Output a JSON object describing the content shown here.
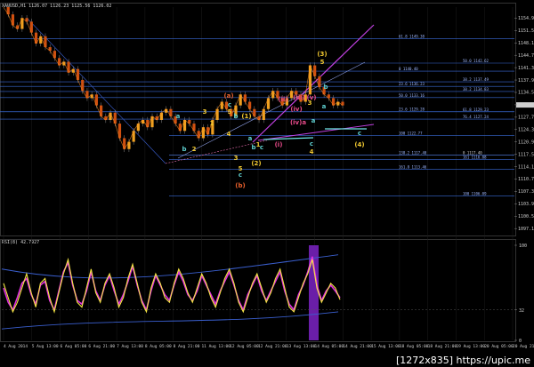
{
  "price_panel": {
    "title": "XAUUSD,H1  1126.07 1126.23 1125.56 1126.02"
  },
  "rsi_panel": {
    "title": "RSI(8) 42.7927",
    "y_ticks": [
      "100",
      "32",
      "0"
    ]
  },
  "watermark": "[1272x835] https://upic.me",
  "chart_data": {
    "type": "candlestick",
    "ylim": [
      1096,
      1158
    ],
    "y_ticks": [
      1154.97,
      1151.57,
      1148.17,
      1144.77,
      1141.37,
      1137.97,
      1134.57,
      1131.17,
      1127.77,
      1124.37,
      1120.97,
      1117.57,
      1114.17,
      1110.77,
      1107.37,
      1103.97,
      1100.57,
      1097.17
    ],
    "current_price": "1131.13",
    "x_ticks": [
      "4 Aug 2014",
      "5 Aug 13:00",
      "6 Aug 05:00",
      "6 Aug 21:00",
      "7 Aug 13:00",
      "8 Aug 05:00",
      "8 Aug 21:00",
      "11 Aug 13:00",
      "12 Aug 05:00",
      "12 Aug 21:00",
      "13 Aug 13:00",
      "14 Aug 05:00",
      "14 Aug 21:00",
      "15 Aug 13:00",
      "18 Aug 05:00",
      "18 Aug 21:00",
      "19 Aug 13:00",
      "20 Aug 05:00",
      "20 Aug 21:00"
    ],
    "price_path": [
      1158,
      1156,
      1153,
      1152,
      1155,
      1154,
      1151,
      1148,
      1150,
      1147,
      1146,
      1144,
      1142,
      1143,
      1140,
      1141,
      1138,
      1135,
      1133,
      1134,
      1131,
      1128,
      1127,
      1129,
      1126,
      1122,
      1119,
      1121,
      1124,
      1126,
      1127,
      1125,
      1128,
      1127,
      1129,
      1130,
      1128,
      1126,
      1124,
      1127,
      1126,
      1124,
      1122,
      1125,
      1123,
      1127,
      1130,
      1132,
      1130,
      1128,
      1131,
      1134,
      1132,
      1130,
      1128,
      1127,
      1130,
      1133,
      1135,
      1133,
      1131,
      1133,
      1135,
      1134,
      1132,
      1134,
      1142,
      1139,
      1136,
      1134,
      1133,
      1131,
      1132,
      1131
    ],
    "fib_levels": [
      {
        "label": "61.8  1149.38",
        "value": 1149.38,
        "color": "#3a6bd8"
      },
      {
        "label": "50.0  1142.62",
        "value": 1142.62,
        "color": "#3a6bd8"
      },
      {
        "label": "0  1140.40",
        "value": 1140.4,
        "color": "#3a6bd8"
      },
      {
        "label": "38.2  1137.49",
        "value": 1137.49,
        "color": "#3a6bd8"
      },
      {
        "label": "23.6  1136.23",
        "value": 1136.23,
        "color": "#3a6bd8"
      },
      {
        "label": "38.2  1134.83",
        "value": 1134.83,
        "color": "#3a6bd8"
      },
      {
        "label": "50.0  1133.16",
        "value": 1133.16,
        "color": "#3a6bd8"
      },
      {
        "label": "61.8  1129.23",
        "value": 1129.23,
        "color": "#3a6bd8"
      },
      {
        "label": "23.6  1129.28",
        "value": 1129.28,
        "color": "#3a6bd8"
      },
      {
        "label": "76.4  1127.24",
        "value": 1127.24,
        "color": "#3a6bd8"
      },
      {
        "label": "100  1122.77",
        "value": 1122.77,
        "color": "#3a6bd8"
      },
      {
        "label": "0  1117.40",
        "value": 1117.4,
        "color": "#cfcfcf"
      },
      {
        "label": "138.2  1117.40",
        "value": 1117.4,
        "color": "#3a6bd8"
      },
      {
        "label": "161  1116.08",
        "value": 1116.08,
        "color": "#3a6bd8"
      },
      {
        "label": "161.8  1113.46",
        "value": 1113.46,
        "color": "#3a6bd8"
      },
      {
        "label": "100  1106.09",
        "value": 1106.09,
        "color": "#3a6bd8"
      }
    ],
    "wave_labels": [
      {
        "text": "a",
        "color": "#5fd0d0"
      },
      {
        "text": "3",
        "color": "#f0c830"
      },
      {
        "text": "b",
        "color": "#5fd0d0"
      },
      {
        "text": "2",
        "color": "#f0c830"
      },
      {
        "text": "1",
        "color": "#f0c830"
      },
      {
        "text": "(a)",
        "color": "#e8602c"
      },
      {
        "text": "c",
        "color": "#5fd0d0"
      },
      {
        "text": "5",
        "color": "#f0c830"
      },
      {
        "text": "b",
        "color": "#5fd0d0"
      },
      {
        "text": "(1)",
        "color": "#f0c830"
      },
      {
        "text": "4",
        "color": "#f0c830"
      },
      {
        "text": "a",
        "color": "#5fd0d0"
      },
      {
        "text": "3",
        "color": "#f0c830"
      },
      {
        "text": "5",
        "color": "#f0c830"
      },
      {
        "text": "c",
        "color": "#5fd0d0"
      },
      {
        "text": "(b)",
        "color": "#e8602c"
      },
      {
        "text": "1",
        "color": "#f0c830"
      },
      {
        "text": "b",
        "color": "#5fd0d0"
      },
      {
        "text": "(2)",
        "color": "#f0c830"
      },
      {
        "text": "c",
        "color": "#5fd0d0"
      },
      {
        "text": "(i)",
        "color": "#e84a8a"
      },
      {
        "text": "(ii)",
        "color": "#e84a8a"
      },
      {
        "text": "(iii)",
        "color": "#e84a8a"
      },
      {
        "text": "(iv)",
        "color": "#e84a8a"
      },
      {
        "text": "(iv)a",
        "color": "#e84a8a"
      },
      {
        "text": "(v)",
        "color": "#e84a8a"
      },
      {
        "text": "3",
        "color": "#f0c830"
      },
      {
        "text": "a",
        "color": "#5fd0d0"
      },
      {
        "text": "c",
        "color": "#5fd0d0"
      },
      {
        "text": "4",
        "color": "#f0c830"
      },
      {
        "text": "(3)",
        "color": "#f0c830"
      },
      {
        "text": "5",
        "color": "#f0c830"
      },
      {
        "text": "b",
        "color": "#5fd0d0"
      },
      {
        "text": "a",
        "color": "#5fd0d0"
      },
      {
        "text": "c",
        "color": "#5fd0d0"
      },
      {
        "text": "(4)",
        "color": "#f0c830"
      }
    ],
    "rsi": {
      "current": 42.7927,
      "ylim": [
        0,
        100
      ],
      "levels": [
        32
      ],
      "yellow": [
        60,
        45,
        30,
        40,
        55,
        70,
        50,
        35,
        60,
        65,
        45,
        30,
        50,
        70,
        85,
        60,
        40,
        35,
        55,
        75,
        50,
        40,
        60,
        70,
        55,
        35,
        45,
        65,
        80,
        60,
        40,
        30,
        55,
        70,
        60,
        45,
        40,
        60,
        75,
        65,
        50,
        40,
        55,
        70,
        60,
        45,
        35,
        50,
        65,
        75,
        60,
        40,
        30,
        45,
        60,
        70,
        55,
        40,
        50,
        65,
        75,
        55,
        35,
        30,
        45,
        60,
        70,
        85,
        55,
        40,
        50,
        60,
        55,
        42.8
      ],
      "magenta": [
        55,
        40,
        32,
        45,
        60,
        65,
        48,
        38,
        58,
        62,
        42,
        32,
        52,
        72,
        82,
        58,
        42,
        38,
        52,
        72,
        52,
        42,
        58,
        68,
        52,
        38,
        48,
        62,
        78,
        58,
        42,
        32,
        52,
        68,
        58,
        48,
        42,
        58,
        72,
        62,
        48,
        42,
        52,
        68,
        58,
        48,
        38,
        52,
        62,
        72,
        58,
        42,
        32,
        48,
        58,
        68,
        52,
        42,
        52,
        62,
        72,
        52,
        38,
        32,
        48,
        58,
        72,
        88,
        58,
        42,
        52,
        58,
        52,
        45
      ]
    }
  }
}
